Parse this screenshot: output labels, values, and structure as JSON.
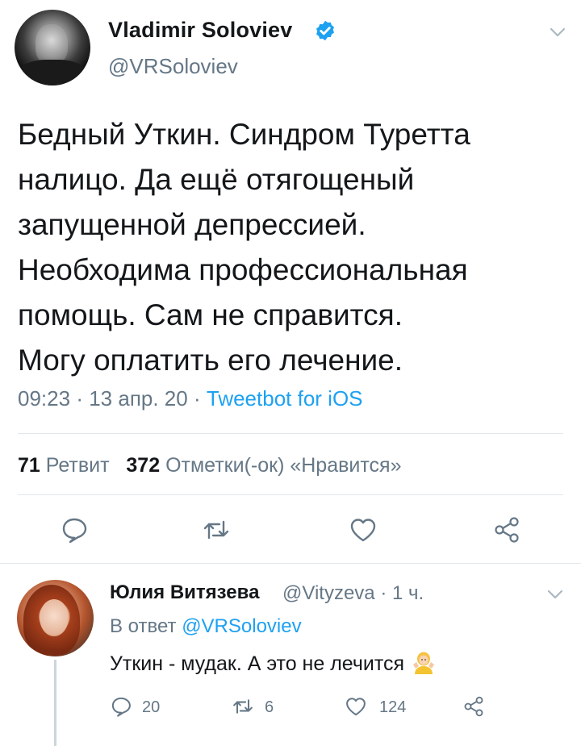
{
  "tweet": {
    "author_name": "Vladimir Soloviev",
    "author_handle": "@VRSoloviev",
    "text": "Бедный Уткин. Синдром Туретта\nналицо. Да ещё отягощеный\nзапущенной депрессией.\nНеобходима профессиональная\nпомощь. Сам не справится.\nМогу оплатить его лечение.",
    "time": "09:23",
    "date": "13 апр. 20",
    "separator": "·",
    "source": "Tweetbot for iOS",
    "retweet_count": "71",
    "retweet_label": "Ретвит",
    "like_count": "372",
    "like_label": "Отметки(-ок) «Нравится»"
  },
  "reply": {
    "author_name": "Юлия Витязева",
    "author_handle": "@Vityzeva",
    "separator": "·",
    "time": "1 ч.",
    "reply_prefix": "В ответ",
    "reply_to": "@VRSoloviev",
    "text": "Уткин - мудак. А это не лечится",
    "reply_count": "20",
    "retweet_count": "6",
    "like_count": "124"
  },
  "colors": {
    "accent": "#1da1f2",
    "secondary_text": "#657786",
    "primary_text": "#14171a",
    "divider": "#e1e8ed"
  },
  "icons": {
    "verified": "verified-badge-icon",
    "menu": "chevron-down-icon",
    "reply": "reply-bubble-icon",
    "retweet": "retweet-icon",
    "like": "heart-icon",
    "share": "share-icon",
    "emoji": "person-shrugging-emoji"
  }
}
